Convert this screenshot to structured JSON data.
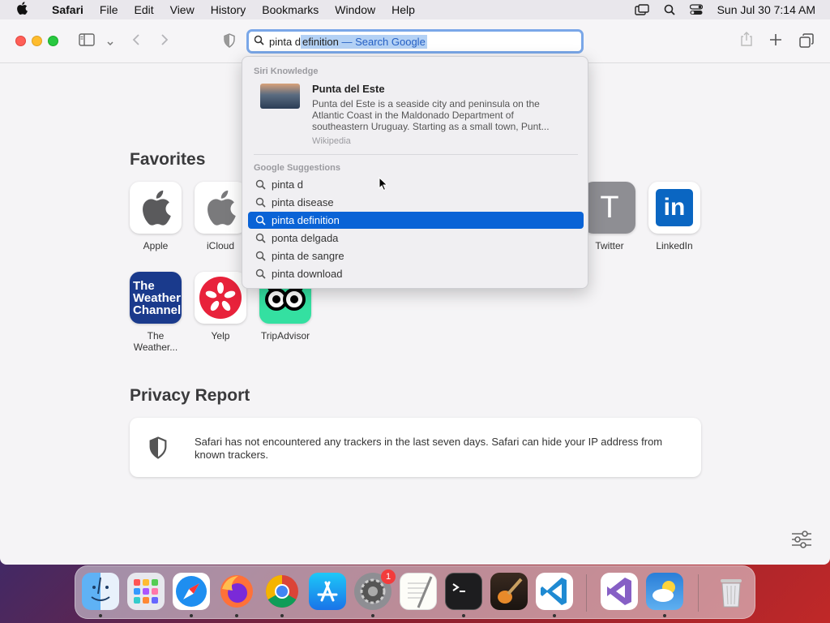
{
  "menubar": {
    "app_name": "Safari",
    "items": [
      "File",
      "Edit",
      "View",
      "History",
      "Bookmarks",
      "Window",
      "Help"
    ],
    "datetime": "Sun Jul 30  7:14 AM"
  },
  "addressbar": {
    "typed": "pinta d",
    "autocomplete": "efinition",
    "hint": " — Search Google"
  },
  "dropdown": {
    "siri_header": "Siri Knowledge",
    "siri_title": "Punta del Este",
    "siri_description": "Punta del Este is a seaside city and peninsula on the Atlantic Coast in the Maldonado Department of southeastern Uruguay. Starting as a small town, Punt...",
    "siri_source": "Wikipedia",
    "google_header": "Google Suggestions",
    "suggestions": [
      "pinta d",
      "pinta disease",
      "pinta definition",
      "ponta delgada",
      "pinta de sangre",
      "pinta download"
    ],
    "active_index": 2
  },
  "favorites": {
    "title": "Favorites",
    "items": [
      {
        "label": "Apple"
      },
      {
        "label": "iCloud"
      },
      {
        "label": "Twitter"
      },
      {
        "label": "LinkedIn"
      },
      {
        "label": "The Weather..."
      },
      {
        "label": "Yelp"
      },
      {
        "label": "TripAdvisor"
      }
    ],
    "weather_tile_text": [
      "The",
      "Weather",
      "Channel"
    ],
    "twitter_tile_letter": "T",
    "linkedin_tile_text": "in"
  },
  "privacy": {
    "title": "Privacy Report",
    "message": "Safari has not encountered any trackers in the last seven days. Safari can hide your IP address from known trackers."
  },
  "dock": {
    "badge_count": "1",
    "apps": [
      "finder-icon",
      "launchpad-icon",
      "safari-icon",
      "firefox-icon",
      "chrome-icon",
      "app-store-icon",
      "system-settings-icon",
      "textedit-icon",
      "terminal-icon",
      "garageband-icon",
      "vscode-icon",
      "visual-studio-icon",
      "weather-icon",
      "trash-icon"
    ]
  },
  "colors": {
    "accent": "#0a63d6",
    "address_focus": "#7aa7e8",
    "weather_blue": "#1a3a8c",
    "yelp_red": "#e8223b",
    "tripadvisor_green": "#34e0a1",
    "linkedin_blue": "#0a66c2",
    "twitter_gray": "#8e8e93"
  }
}
